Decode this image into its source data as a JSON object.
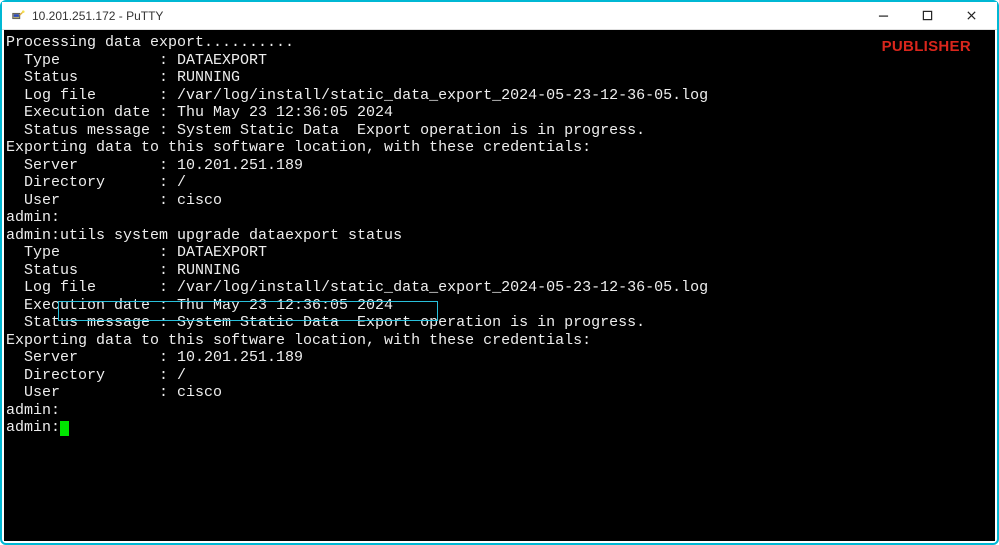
{
  "titlebar": {
    "title": "10.201.251.172 - PuTTY"
  },
  "watermark": "PUBLISHER",
  "highlighted_command": "utils system upgrade dataexport status",
  "t": {
    "l1": "Processing data export..........",
    "l2": "",
    "l3": "  Type           : DATAEXPORT",
    "l4": "  Status         : RUNNING",
    "l5": "  Log file       : /var/log/install/static_data_export_2024-05-23-12-36-05.log",
    "l6": "  Execution date : Thu May 23 12:36:05 2024",
    "l7": "  Status message : System Static Data  Export operation is in progress.",
    "l8": "",
    "l9": "Exporting data to this software location, with these credentials:",
    "l10": "  Server         : 10.201.251.189",
    "l11": "  Directory      : /",
    "l12": "  User           : cisco",
    "l13": "",
    "l14": "admin:",
    "l15": "admin:utils system upgrade dataexport status",
    "l16": "",
    "l17": "  Type           : DATAEXPORT",
    "l18": "  Status         : RUNNING",
    "l19": "  Log file       : /var/log/install/static_data_export_2024-05-23-12-36-05.log",
    "l20": "  Execution date : Thu May 23 12:36:05 2024",
    "l21": "  Status message : System Static Data  Export operation is in progress.",
    "l22": "",
    "l23": "Exporting data to this software location, with these credentials:",
    "l24": "  Server         : 10.201.251.189",
    "l25": "  Directory      : /",
    "l26": "  User           : cisco",
    "l27": "",
    "l28": "admin:",
    "l29": "admin:"
  }
}
